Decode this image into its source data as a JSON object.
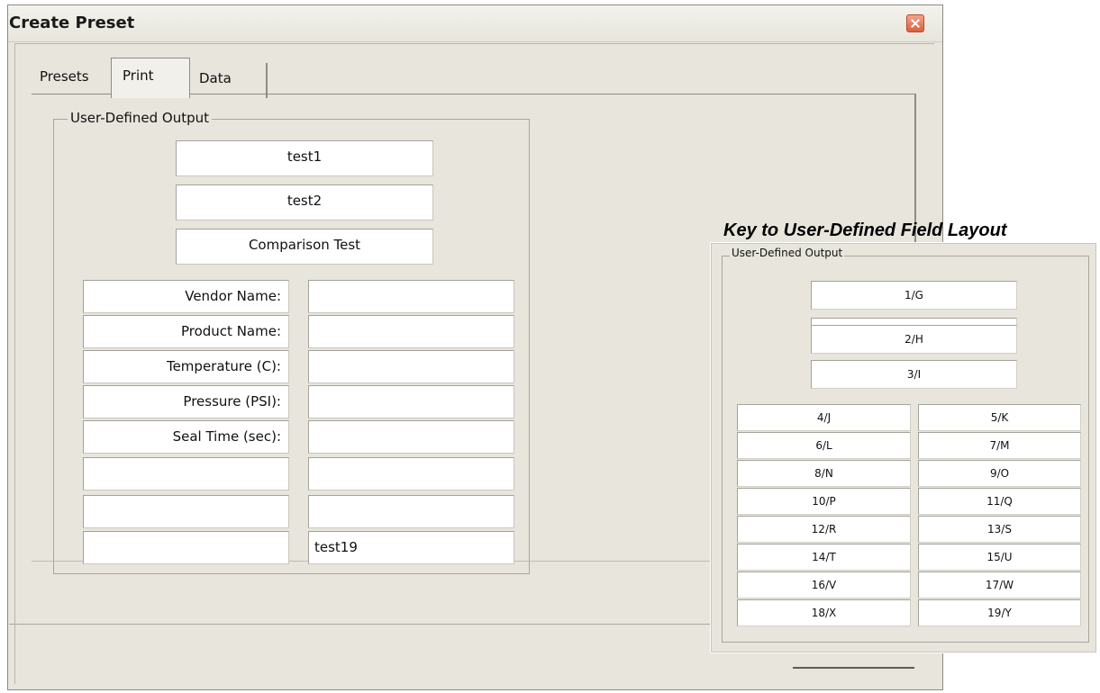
{
  "window": {
    "title": "Create Preset"
  },
  "tabs": [
    "Presets",
    "Print",
    "Data"
  ],
  "group_label": "User-Defined Output",
  "top_fields": [
    "test1",
    "test2",
    "Comparison Test"
  ],
  "rows": [
    {
      "label": "Vendor Name:",
      "value": ""
    },
    {
      "label": "Product Name:",
      "value": ""
    },
    {
      "label": "Temperature (C):",
      "value": ""
    },
    {
      "label": "Pressure (PSI):",
      "value": ""
    },
    {
      "label": "Seal Time (sec):",
      "value": ""
    },
    {
      "label": "",
      "value": ""
    },
    {
      "label": "",
      "value": ""
    },
    {
      "label": "",
      "value": "test19"
    }
  ],
  "key": {
    "title": "Key to User-Defined Field Layout",
    "group_label": "User-Defined Output",
    "top_fields": [
      "1/G",
      "2/H",
      "3/I"
    ],
    "rows": [
      {
        "left": "4/J",
        "right": "5/K"
      },
      {
        "left": "6/L",
        "right": "7/M"
      },
      {
        "left": "8/N",
        "right": "9/O"
      },
      {
        "left": "10/P",
        "right": "11/Q"
      },
      {
        "left": "12/R",
        "right": "13/S"
      },
      {
        "left": "14/T",
        "right": "15/U"
      },
      {
        "left": "16/V",
        "right": "17/W"
      },
      {
        "left": "18/X",
        "right": "19/Y"
      }
    ]
  }
}
